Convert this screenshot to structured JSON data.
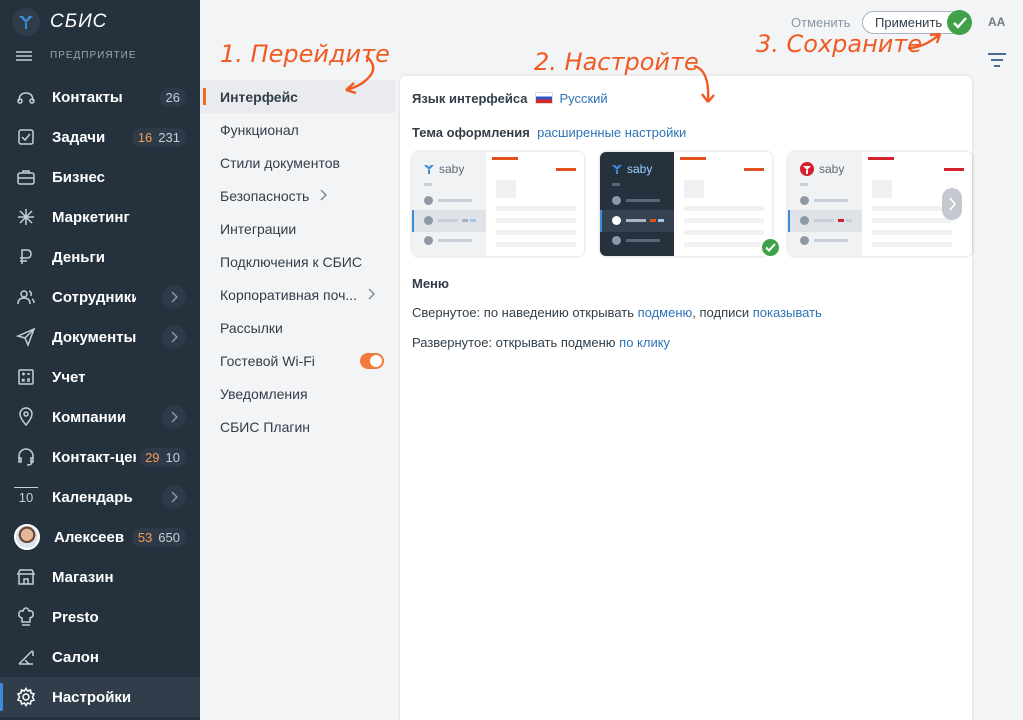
{
  "app": {
    "brand": "СБИС",
    "org": "ПРЕДПРИЯТИЕ"
  },
  "sidebar": {
    "items": [
      {
        "label": "Контакты",
        "count": "26",
        "icon": "contacts-icon"
      },
      {
        "label": "Задачи",
        "count_hot": "16",
        "count": "231",
        "icon": "tasks-icon"
      },
      {
        "label": "Бизнес",
        "icon": "business-icon"
      },
      {
        "label": "Маркетинг",
        "icon": "marketing-icon"
      },
      {
        "label": "Деньги",
        "icon": "money-icon"
      },
      {
        "label": "Сотрудники",
        "icon": "staff-icon",
        "chevron": true
      },
      {
        "label": "Документы",
        "icon": "documents-icon",
        "chevron": true
      },
      {
        "label": "Учет",
        "icon": "accounting-icon"
      },
      {
        "label": "Компании",
        "icon": "companies-icon",
        "chevron": true
      },
      {
        "label": "Контакт-центр",
        "count_hot": "29",
        "count": "10",
        "icon": "contact-center-icon"
      },
      {
        "label": "Календарь",
        "icon": "calendar-icon",
        "chevron": true,
        "day": "10"
      },
      {
        "label": "Алексеев",
        "count_hot": "53",
        "count": "650",
        "icon": "avatar"
      },
      {
        "label": "Магазин",
        "icon": "shop-icon"
      },
      {
        "label": "Presto",
        "icon": "chef-icon"
      },
      {
        "label": "Салон",
        "icon": "salon-icon"
      },
      {
        "label": "Настройки",
        "icon": "settings-icon",
        "active": true
      }
    ]
  },
  "topbar": {
    "cancel_label": "Отменить",
    "apply_label": "Применить",
    "font_size_label": "AA"
  },
  "settings_menu": {
    "items": [
      {
        "label": "Интерфейс",
        "active": true
      },
      {
        "label": "Функционал"
      },
      {
        "label": "Стили документов"
      },
      {
        "label": "Безопасность",
        "chevron": true
      },
      {
        "label": "Интеграции"
      },
      {
        "label": "Подключения к СБИС"
      },
      {
        "label": "Корпоративная поч...",
        "chevron": true
      },
      {
        "label": "Рассылки"
      },
      {
        "label": "Гостевой Wi-Fi",
        "toggle": true,
        "toggle_on": true
      },
      {
        "label": "Уведомления"
      },
      {
        "label": "СБИС Плагин"
      }
    ]
  },
  "panel": {
    "language_label": "Язык интерфейса",
    "language_value": "Русский",
    "theme_label": "Тема оформления",
    "theme_link": "расширенные настройки",
    "theme_logo_text": "saby",
    "menu_heading": "Меню",
    "collapsed_text1": "Свернутое: по наведению открывать ",
    "collapsed_link1": "подменю",
    "collapsed_text2": ", подписи ",
    "collapsed_link2": "показывать",
    "expanded_text": "Развернутое: открывать подменю ",
    "expanded_link": "по клику"
  },
  "annotations": {
    "step1": "1. Перейдите",
    "step2": "2. Настройте",
    "step3": "3. Сохраните"
  },
  "colors": {
    "accent_orange": "#f15a22",
    "success_green": "#3fa24a",
    "link_blue": "#2e73b8",
    "sidebar_bg": "#26313e"
  }
}
